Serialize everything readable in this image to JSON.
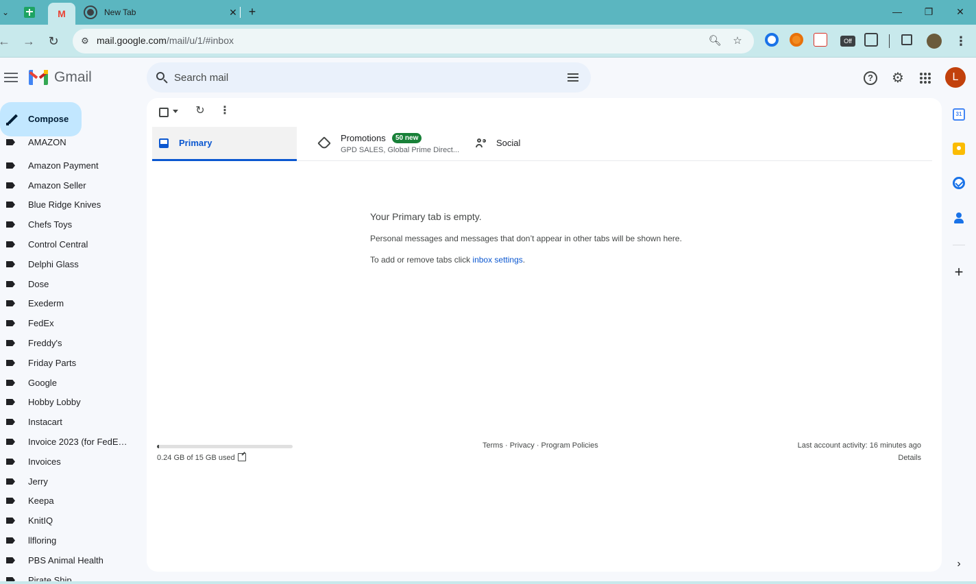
{
  "browser": {
    "tabs": [
      {
        "title": "",
        "icon": "sheets-icon"
      },
      {
        "title": "",
        "icon": "gmail-icon"
      },
      {
        "title": "New Tab",
        "icon": "chrome-icon"
      }
    ],
    "url_domain": "mail.google.com",
    "url_path": "/mail/u/1/#inbox",
    "extension_off_badge": "Off"
  },
  "app": {
    "name": "Gmail",
    "search_placeholder": "Search mail",
    "avatar_initial": "L",
    "compose_label": "Compose"
  },
  "sidebar": {
    "partial_top_label": "AMAZON",
    "labels": [
      "Amazon Payment",
      "Amazon Seller",
      "Blue Ridge Knives",
      "Chefs Toys",
      "Control Central",
      "Delphi Glass",
      "Dose",
      "Exederm",
      "FedEx",
      "Freddy's",
      "Friday Parts",
      "Google",
      "Hobby Lobby",
      "Instacart",
      "Invoice 2023 (for FedEx ...",
      "Invoices",
      "Jerry",
      "Keepa",
      "KnitIQ",
      "llfloring",
      "PBS Animal Health",
      "Pirate Ship"
    ]
  },
  "tabs": {
    "primary": "Primary",
    "promotions": "Promotions",
    "promotions_badge": "50 new",
    "promotions_senders": "GPD SALES, Global Prime Direct...",
    "social": "Social"
  },
  "empty_state": {
    "title": "Your Primary tab is empty.",
    "description": "Personal messages and messages that don’t appear in other tabs will be shown here.",
    "hint_prefix": "To add or remove tabs click ",
    "hint_link": "inbox settings",
    "hint_suffix": "."
  },
  "footer": {
    "storage_used_fraction": 0.016,
    "storage_text": "0.24 GB of 15 GB used",
    "links": "Terms · Privacy · Program Policies",
    "last_activity": "Last account activity: 16 minutes ago",
    "details": "Details"
  },
  "colors": {
    "browser_frame": "#5bb6c0",
    "toolbar": "#c8e9ec",
    "compose_bg": "#c2e7ff",
    "primary_accent": "#0b57d0",
    "badge_green": "#188038",
    "avatar_bg": "#c2410c"
  }
}
